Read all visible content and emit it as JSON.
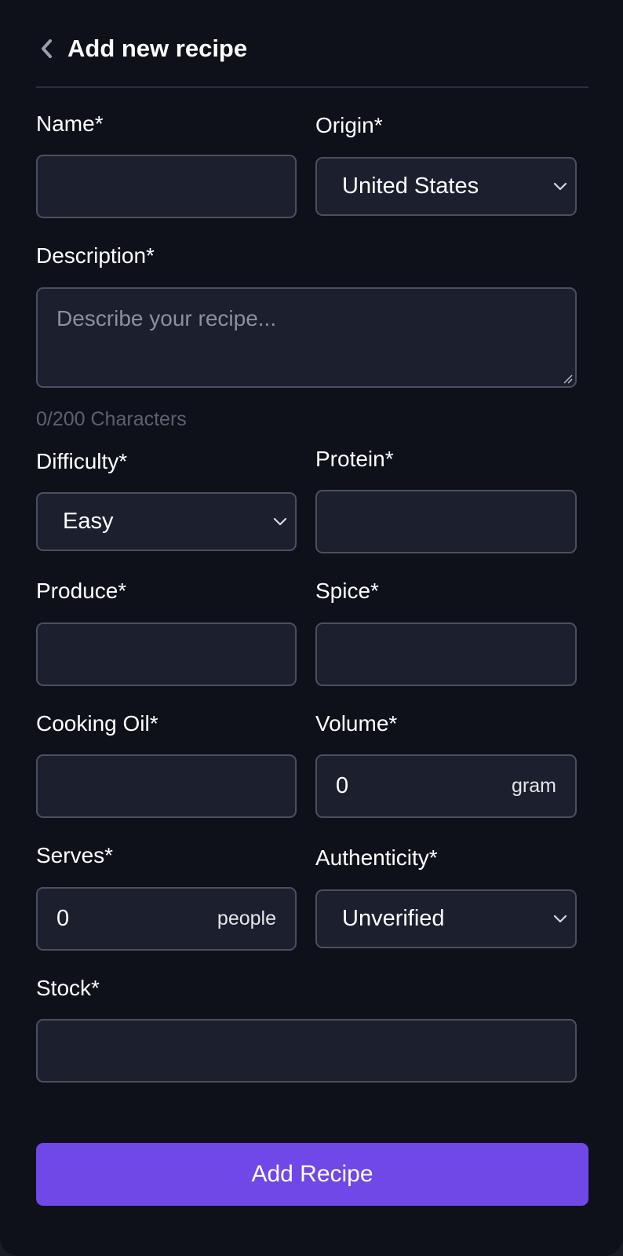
{
  "header": {
    "title": "Add new recipe"
  },
  "form": {
    "name": {
      "label": "Name*",
      "value": ""
    },
    "origin": {
      "label": "Origin*",
      "selected": "United States"
    },
    "description": {
      "label": "Description*",
      "placeholder": "Describe your recipe...",
      "counter": "0/200 Characters"
    },
    "difficulty": {
      "label": "Difficulty*",
      "selected": "Easy"
    },
    "protein": {
      "label": "Protein*",
      "value": ""
    },
    "produce": {
      "label": "Produce*",
      "value": ""
    },
    "spice": {
      "label": "Spice*",
      "value": ""
    },
    "cooking_oil": {
      "label": "Cooking Oil*",
      "value": ""
    },
    "volume": {
      "label": "Volume*",
      "value": "0",
      "unit": "gram"
    },
    "serves": {
      "label": "Serves*",
      "value": "0",
      "unit": "people"
    },
    "authenticity": {
      "label": "Authenticity*",
      "selected": "Unverified"
    },
    "stock": {
      "label": "Stock*",
      "value": ""
    }
  },
  "submit": {
    "label": "Add Recipe"
  },
  "icons": {
    "back": "chevron-left-icon",
    "dropdown": "chevron-down-icon"
  },
  "colors": {
    "background": "#0f111a",
    "field": "#1b1f2e",
    "field_border": "#4a5060",
    "accent": "#7048e8",
    "muted_text": "#5c6170"
  }
}
